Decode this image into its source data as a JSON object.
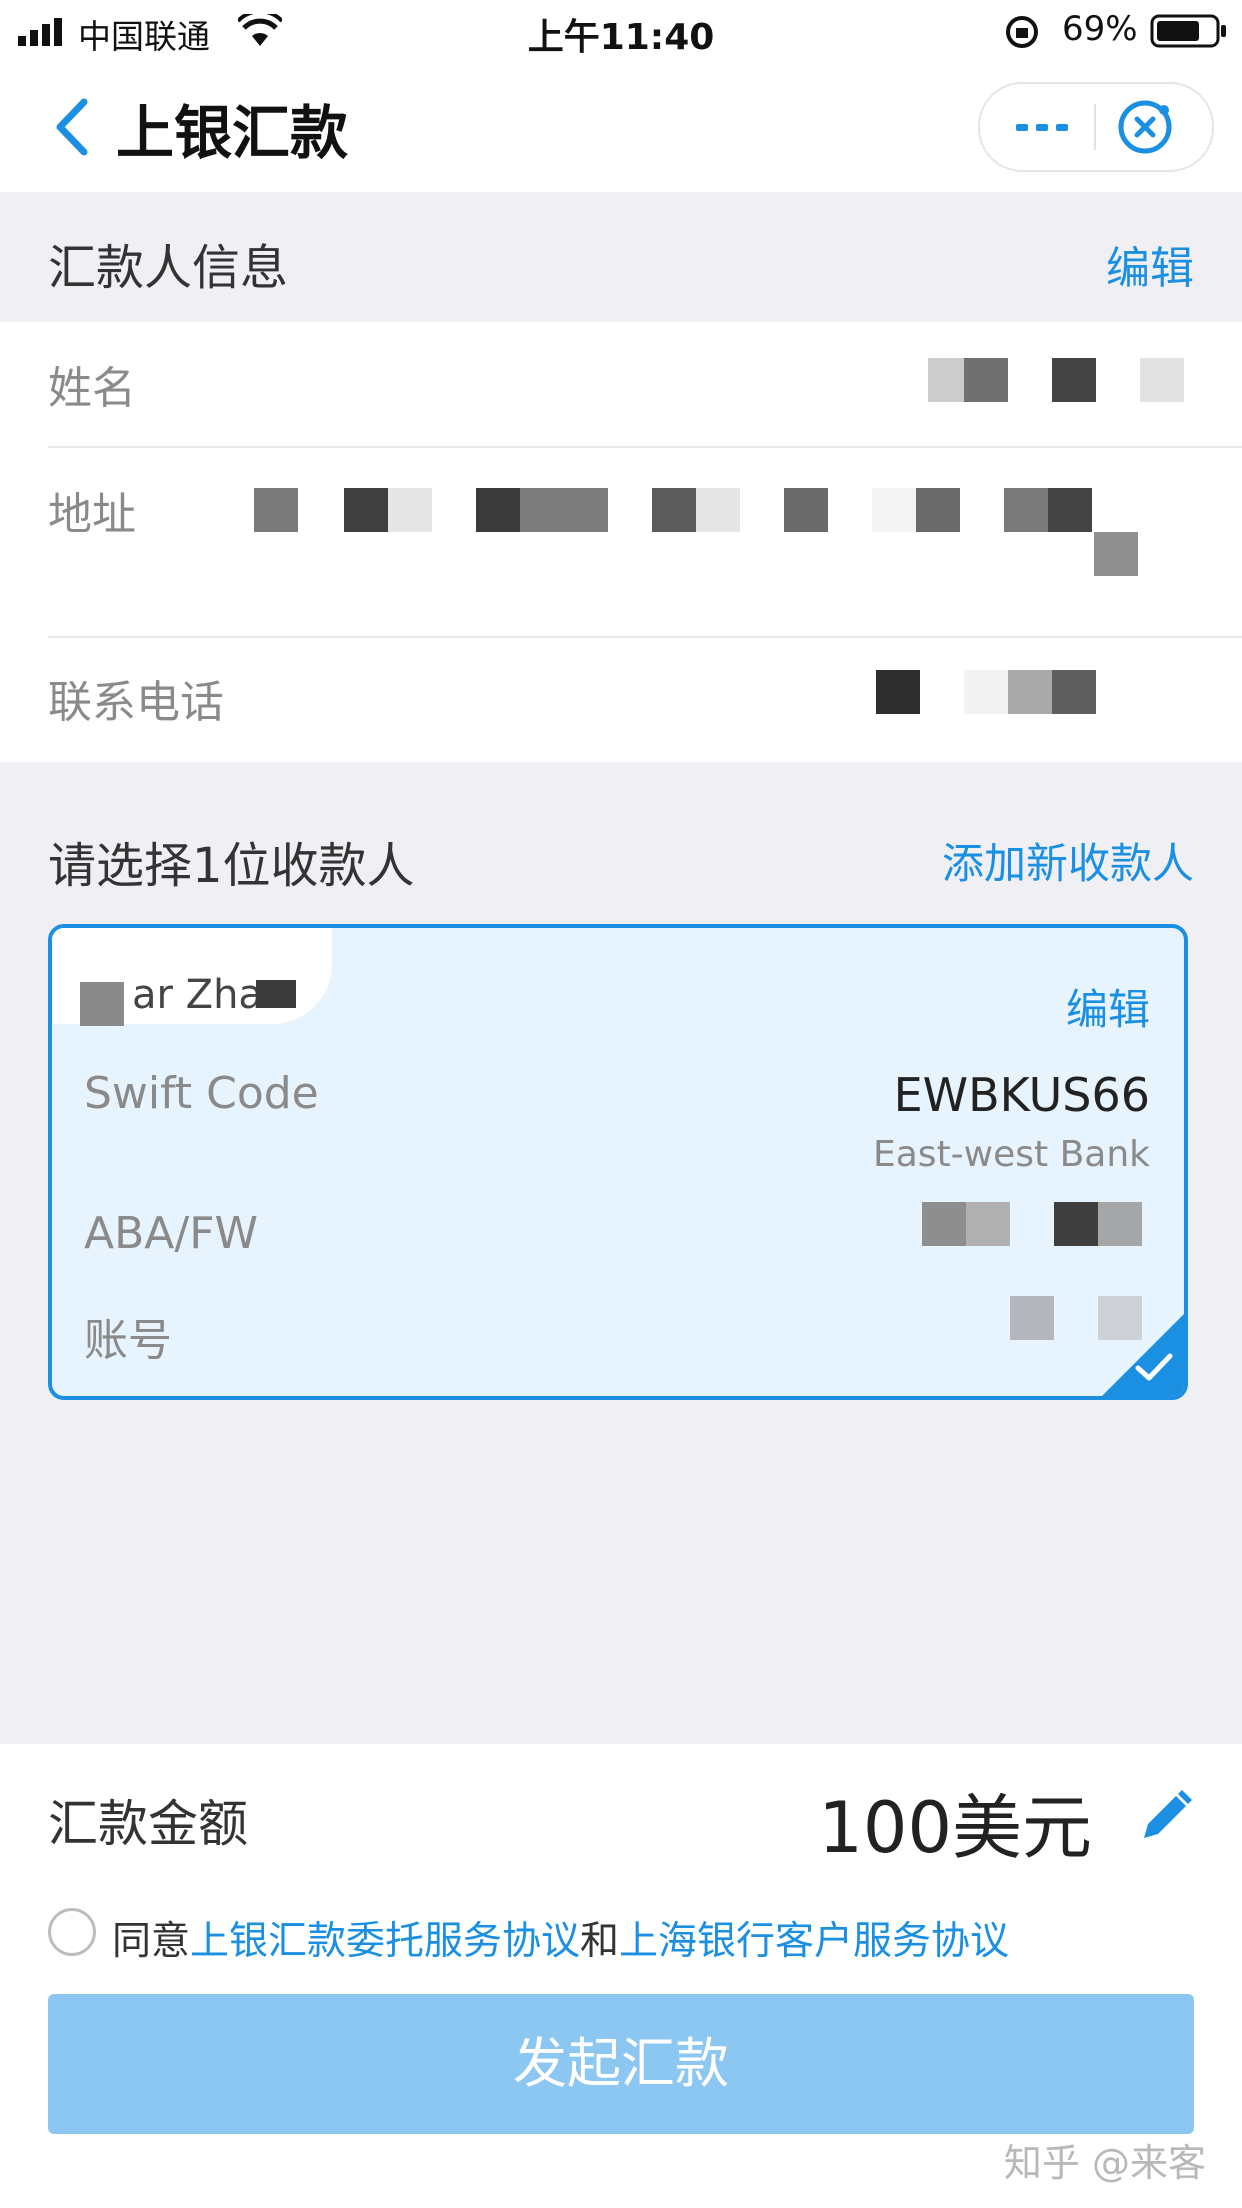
{
  "status_bar": {
    "carrier": "中国联通",
    "time": "上午11:40",
    "battery": "69%"
  },
  "nav": {
    "title": "上银汇款",
    "back_icon": "chevron-left-icon",
    "more_icon": "more-dots-icon",
    "close_icon": "close-circle-icon"
  },
  "sender": {
    "section_label": "汇款人信息",
    "edit": "编辑",
    "fields": [
      {
        "label": "姓名"
      },
      {
        "label": "地址"
      },
      {
        "label": "联系电话"
      }
    ]
  },
  "recipients": {
    "title": "请选择1位收款人",
    "add_new": "添加新收款人",
    "card": {
      "name_partial": "ar Zha",
      "edit": "编辑",
      "swift_label": "Swift Code",
      "swift_value": "EWBKUS66",
      "bank_name": "East-west Bank",
      "aba_label": "ABA/FW",
      "account_label": "账号",
      "selected": true
    }
  },
  "bottom": {
    "amount_label": "汇款金额",
    "amount_value": "100美元",
    "agree_prefix": "同意",
    "agreement_1": "上银汇款委托服务协议",
    "agree_and": "和",
    "agreement_2": "上海银行客户服务协议",
    "submit": "发起汇款"
  },
  "watermark": "知乎 @来客",
  "colors": {
    "accent": "#1b8fe1",
    "submit_disabled": "#8cc7f2",
    "card_bg": "#e7f4fd",
    "page_bg": "#efeff4"
  }
}
